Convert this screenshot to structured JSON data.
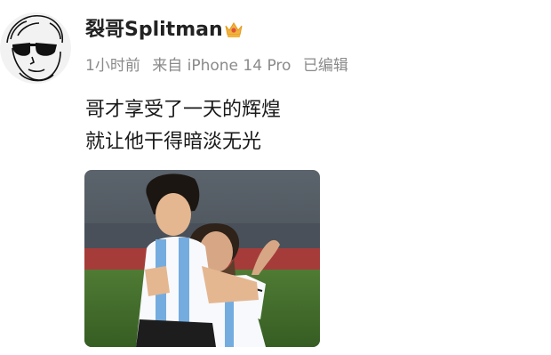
{
  "post": {
    "author": "裂哥Splitman",
    "badge_icon": "crown-icon",
    "meta": {
      "time": "1小时前",
      "source": "来自 iPhone 14 Pro",
      "edited": "已编辑"
    },
    "lines": [
      "哥才享受了一天的辉煌",
      "就让他干得暗淡无光"
    ],
    "image": {
      "description_icon": "post-photo",
      "accent": "#74acdf"
    }
  }
}
